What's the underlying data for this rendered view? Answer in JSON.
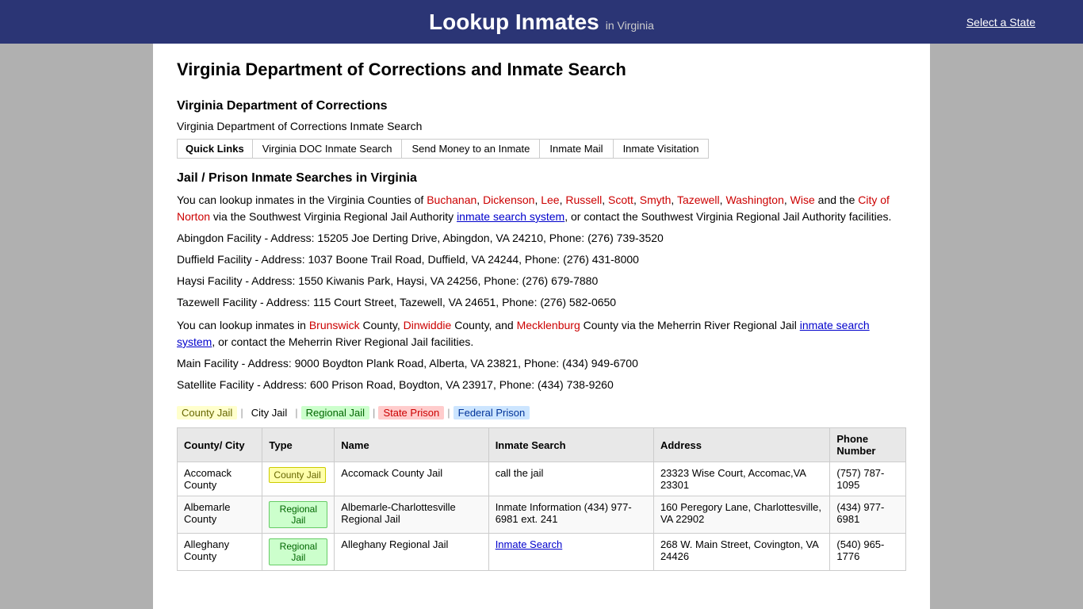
{
  "header": {
    "title": "Lookup Inmates",
    "in_state": "in Virginia",
    "select_state": "Select a State"
  },
  "page": {
    "main_title": "Virginia Department of Corrections and Inmate Search",
    "doc_section": {
      "title": "Virginia Department of Corrections",
      "subtitle": "Virginia Department of Corrections Inmate Search",
      "quick_links": {
        "label": "Quick Links",
        "links": [
          "Virginia DOC Inmate Search",
          "Send Money to an Inmate",
          "Inmate Mail",
          "Inmate Visitation"
        ]
      }
    },
    "jail_section": {
      "title": "Jail / Prison Inmate Searches in Virginia",
      "svr_paragraph": "You can lookup inmates in the Virginia Counties of Buchanan, Dickenson, Lee, Russell, Scott, Smyth, Tazewell, Washington, Wise and the City of Norton via the Southwest Virginia Regional Jail Authority inmate search system, or contact the Southwest Virginia Regional Jail Authority facilities.",
      "svr_counties": [
        "Buchanan",
        "Dickenson",
        "Lee",
        "Russell",
        "Scott",
        "Smyth",
        "Tazewell",
        "Washington",
        "Wise"
      ],
      "svr_city": "City of Norton",
      "svr_facilities": [
        "Abingdon Facility - Address: 15205 Joe Derting Drive, Abingdon, VA 24210, Phone: (276) 739-3520",
        "Duffield Facility - Address: 1037 Boone Trail Road, Duffield, VA 24244, Phone: (276) 431-8000",
        "Haysi Facility - Address: 1550 Kiwanis Park, Haysi, VA 24256, Phone: (276) 679-7880",
        "Tazewell Facility - Address: 115 Court Street, Tazewell, VA 24651, Phone: (276) 582-0650"
      ],
      "merr_paragraph": "You can lookup inmates in Brunswick County, Dinwiddie County, and Mecklenburg County via the Meherrin River Regional Jail inmate search system, or contact the Meherrin River Regional Jail facilities.",
      "merr_counties": [
        "Brunswick",
        "Dinwiddie",
        "Mecklenburg"
      ],
      "merr_facilities": [
        "Main Facility - Address: 9000 Boydton Plank Road, Alberta, VA 23821, Phone: (434) 949-6700",
        "Satellite Facility - Address: 600 Prison Road, Boydton, VA 23917, Phone: (434) 738-9260"
      ]
    },
    "legend": {
      "items": [
        {
          "label": "County Jail",
          "type": "county"
        },
        {
          "label": "City Jail",
          "type": "city"
        },
        {
          "label": "Regional Jail",
          "type": "regional"
        },
        {
          "label": "State Prison",
          "type": "state"
        },
        {
          "label": "Federal Prison",
          "type": "federal"
        }
      ]
    },
    "table": {
      "headers": [
        "County/ City",
        "Type",
        "Name",
        "Inmate Search",
        "Address",
        "Phone Number"
      ],
      "rows": [
        {
          "county": "Accomack County",
          "type": "County Jail",
          "type_class": "county",
          "name": "Accomack County Jail",
          "inmate_search": "call the jail",
          "inmate_search_link": false,
          "address": "23323 Wise Court, Accomac, VA 23301",
          "phone": "(757) 787-1095"
        },
        {
          "county": "Albemarle County",
          "type": "Regional Jail",
          "type_class": "regional",
          "name": "Albemarle-Charlottesville Regional Jail",
          "inmate_search": "Inmate Information (434) 977-6981 ext. 241",
          "inmate_search_link": false,
          "address": "160 Peregory Lane, Charlottesville, VA 22902",
          "phone": "(434) 977-6981"
        },
        {
          "county": "Alleghany County",
          "type": "Regional Jail",
          "type_class": "regional",
          "name": "Alleghany Regional Jail",
          "inmate_search": "Inmate Search",
          "inmate_search_link": true,
          "address": "268 W. Main Street, Covington, VA 24426",
          "phone": "(540) 965-1776"
        }
      ]
    }
  }
}
